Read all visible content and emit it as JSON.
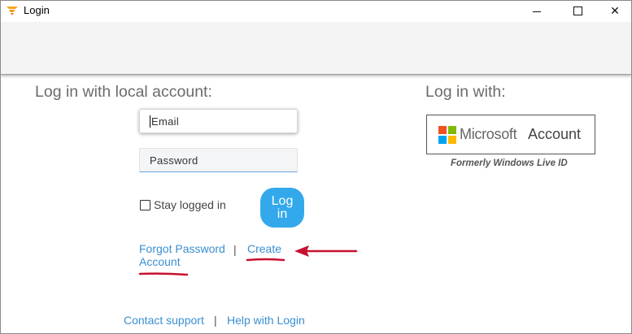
{
  "window": {
    "title": "Login",
    "controls": {
      "minimize": "",
      "maximize": "",
      "close": "✕"
    }
  },
  "local_login": {
    "heading": "Log in with local account:",
    "email_placeholder": "Email",
    "password_placeholder": "Password",
    "stay_logged_in_label": "Stay logged in",
    "stay_logged_in_checked": false,
    "login_button_label": "Log in",
    "forgot_password_label": "Forgot Password",
    "separator": "|",
    "create_account_label_line1": "Create",
    "create_account_label_line2": "Account"
  },
  "external_login": {
    "heading": "Log in with:",
    "microsoft_brand": "Microsoft",
    "microsoft_account_label": "Account",
    "note": "Formerly Windows Live ID",
    "logo_colors": [
      "#f25022",
      "#7fba00",
      "#00a4ef",
      "#ffb900"
    ]
  },
  "footer": {
    "contact_support": "Contact support",
    "separator": "|",
    "help_with_login": "Help with Login"
  },
  "colors": {
    "link": "#3a8fd0",
    "login_button": "#33a9ec",
    "annotation": "#c8102e"
  }
}
